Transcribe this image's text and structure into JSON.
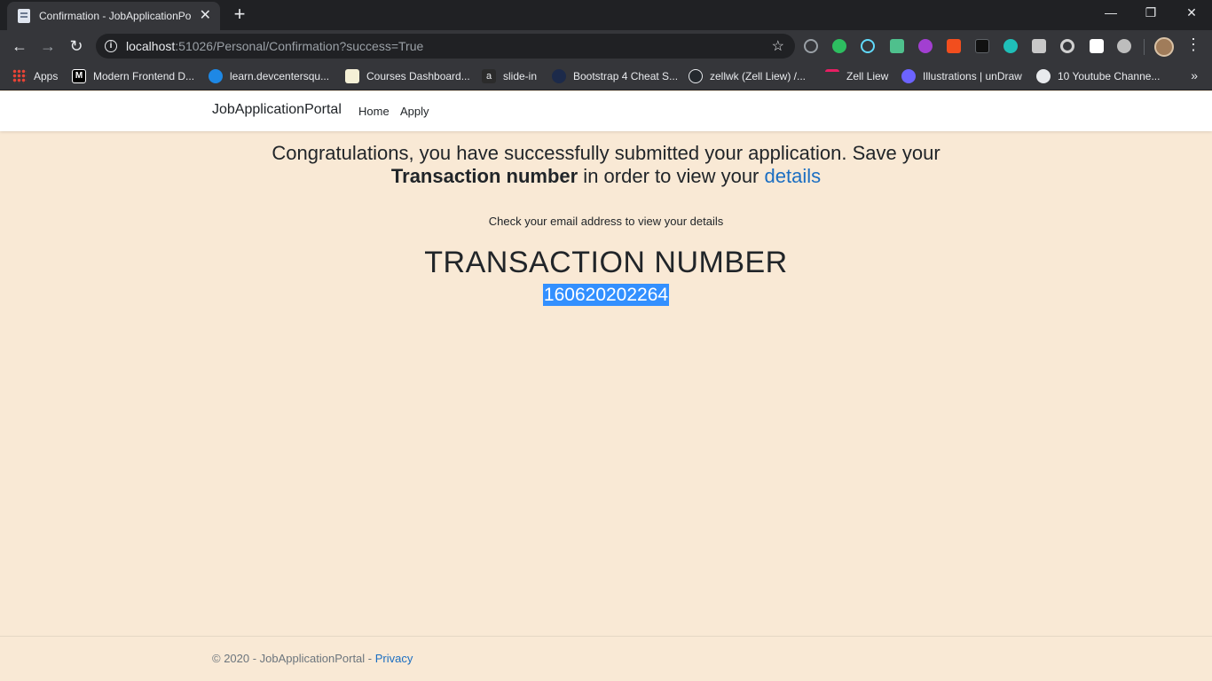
{
  "browser": {
    "tab_title": "Confirmation - JobApplicationPo",
    "url_host": "localhost",
    "url_rest": ":51026/Personal/Confirmation?success=True",
    "bookmarks": [
      {
        "label": "Apps",
        "icon": "apps-grid-icon"
      },
      {
        "label": "Modern Frontend D...",
        "icon": "medium-icon"
      },
      {
        "label": "learn.devcentersqu...",
        "icon": "devcenter-icon"
      },
      {
        "label": "Courses Dashboard...",
        "icon": "crown-icon"
      },
      {
        "label": "slide-in",
        "icon": "a-icon"
      },
      {
        "label": "Bootstrap 4 Cheat S...",
        "icon": "hashnode-icon"
      },
      {
        "label": "zellwk (Zell Liew) /...",
        "icon": "github-icon"
      },
      {
        "label": "Zell Liew",
        "icon": "zell-icon"
      },
      {
        "label": "Illustrations | unDraw",
        "icon": "undraw-icon"
      },
      {
        "label": "10 Youtube Channe...",
        "icon": "globe-icon"
      }
    ]
  },
  "navbar": {
    "brand": "JobApplicationPortal",
    "links": [
      "Home",
      "Apply"
    ]
  },
  "main": {
    "congrats_text": "Congratulations, you have successfully submitted your application. Save your",
    "congrats_bold": "Transaction number",
    "congrats_middle": " in order to view your ",
    "congrats_link": "details",
    "email_note": "Check your email address to view your details",
    "tx_title": "TRANSACTION NUMBER",
    "tx_number": "160620202264"
  },
  "footer": {
    "copyright": "© 2020 - JobApplicationPortal - ",
    "privacy": "Privacy"
  },
  "colors": {
    "page_bg": "#f9e9d5",
    "link": "#1b6ec2",
    "selection": "#3390ff"
  }
}
